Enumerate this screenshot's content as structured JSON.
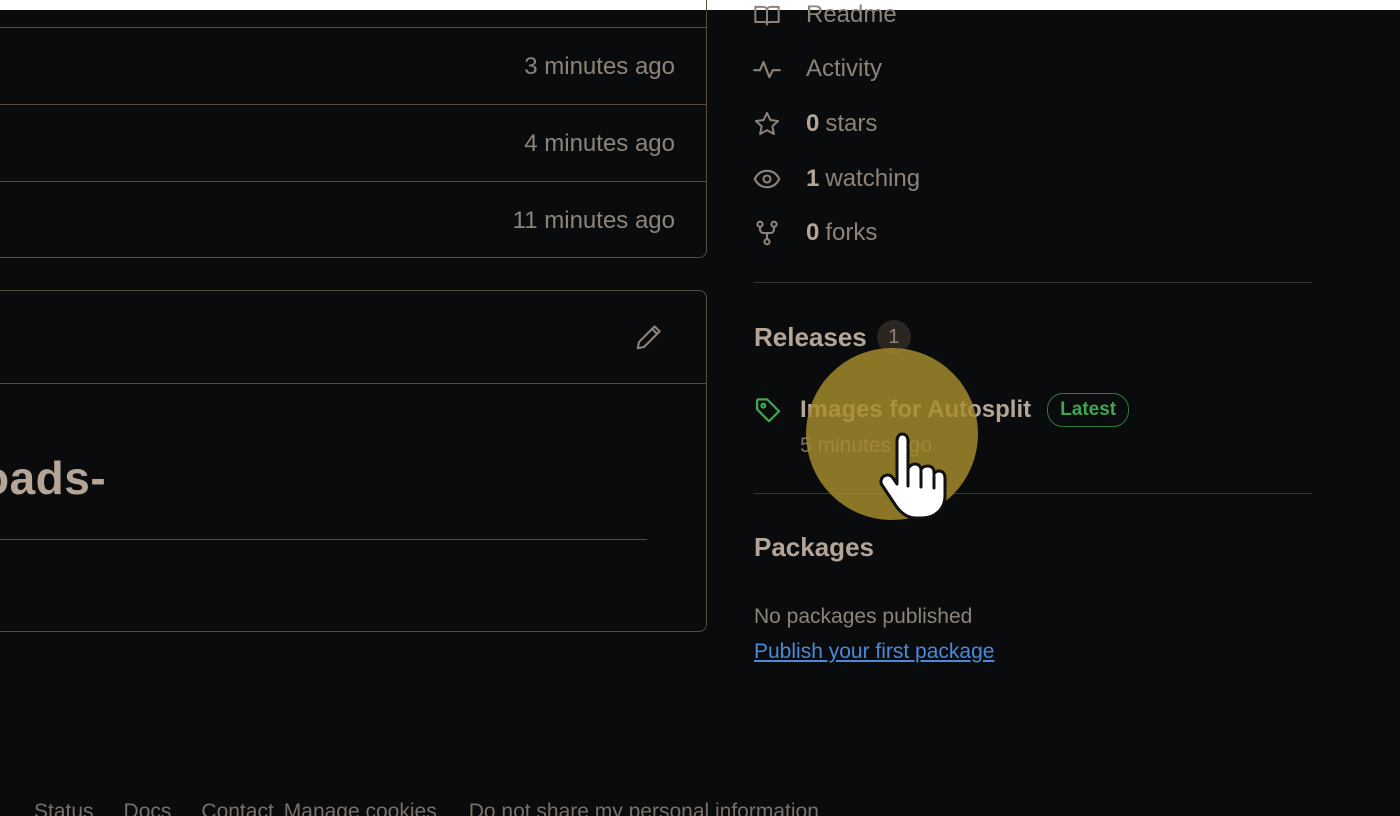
{
  "file_list": {
    "rows": [
      {
        "time": "3 minutes ago"
      },
      {
        "time": "4 minutes ago"
      },
      {
        "time": "11 minutes ago"
      }
    ]
  },
  "readme": {
    "heading_fragment": "oads-",
    "edit_icon": "pencil-icon"
  },
  "sidebar": {
    "links": {
      "readme": {
        "label": "Readme",
        "icon": "book-icon"
      },
      "activity": {
        "label": "Activity",
        "icon": "pulse-icon"
      },
      "stars": {
        "count": "0",
        "label": "stars",
        "icon": "star-icon"
      },
      "watching": {
        "count": "1",
        "label": "watching",
        "icon": "eye-icon"
      },
      "forks": {
        "count": "0",
        "label": "forks",
        "icon": "fork-icon"
      }
    },
    "releases": {
      "title": "Releases",
      "count": "1",
      "latest": {
        "name": "Images for Autosplit",
        "badge": "Latest",
        "time": "5 minutes ago",
        "icon": "tag-icon"
      }
    },
    "packages": {
      "title": "Packages",
      "empty_text": "No packages published",
      "publish_link": "Publish your first package"
    }
  },
  "footer": {
    "links": [
      "Status",
      "Docs",
      "Contact",
      "Manage cookies",
      "Do not share my personal information"
    ]
  },
  "colors": {
    "background": "#0a0b0c",
    "border": "#5a4a3c",
    "muted_text": "#8e8378",
    "strong_text": "#b4a596",
    "green_accent": "#3fa650",
    "link_blue": "#4a8ad8",
    "cursor_highlight": "#a88c2c"
  }
}
